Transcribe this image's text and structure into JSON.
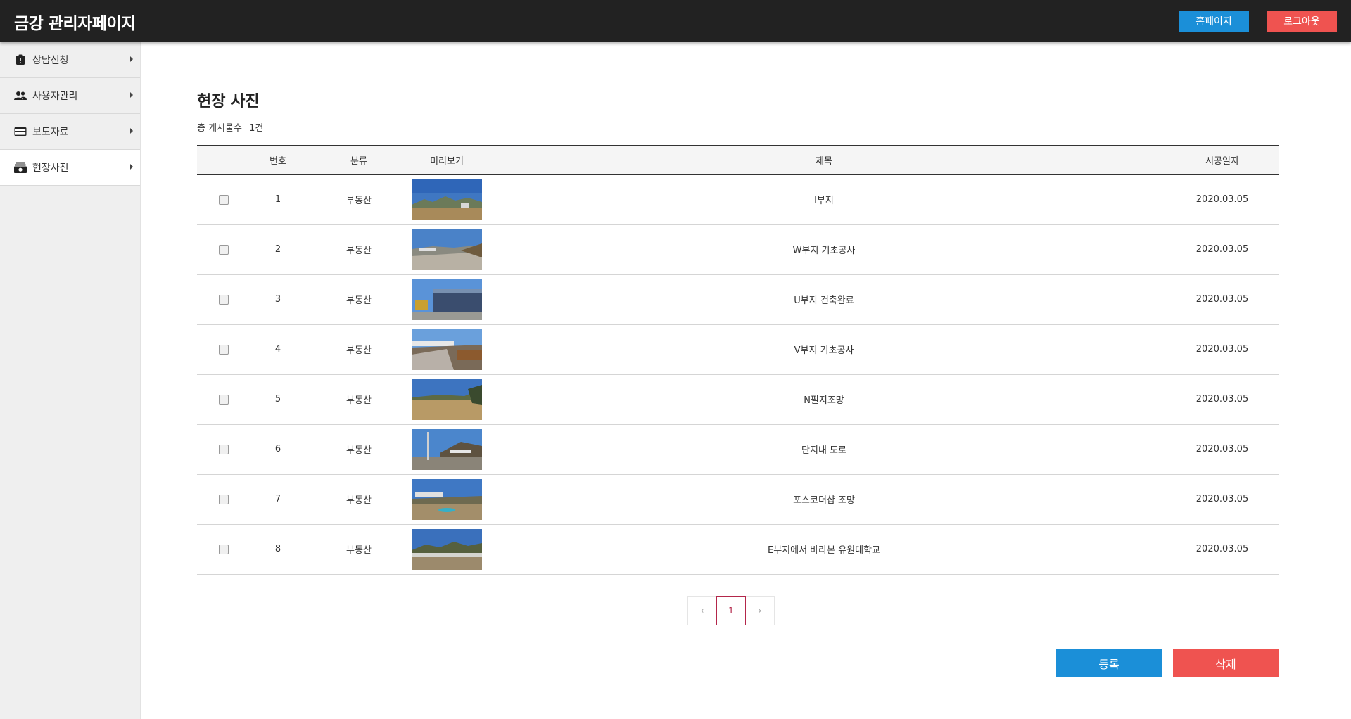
{
  "header": {
    "app_title": "금강 관리자페이지",
    "home_label": "홈페이지",
    "logout_label": "로그아웃"
  },
  "sidebar": {
    "items": [
      {
        "label": "상담신청",
        "icon": "clipboard-alert-icon",
        "active": false
      },
      {
        "label": "사용자관리",
        "icon": "users-icon",
        "active": false
      },
      {
        "label": "보도자료",
        "icon": "card-icon",
        "active": false
      },
      {
        "label": "현장사진",
        "icon": "photo-archive-icon",
        "active": true
      }
    ]
  },
  "main": {
    "title": "현장 사진",
    "total_label": "총 게시물수",
    "total_value": "1건",
    "table": {
      "headers": [
        "",
        "번호",
        "분류",
        "미리보기",
        "제목",
        "시공일자"
      ],
      "rows": [
        {
          "num": "1",
          "category": "부동산",
          "title": "I부지",
          "date": "2020.03.05"
        },
        {
          "num": "2",
          "category": "부동산",
          "title": "W부지 기초공사",
          "date": "2020.03.05"
        },
        {
          "num": "3",
          "category": "부동산",
          "title": "U부지 건축완료",
          "date": "2020.03.05"
        },
        {
          "num": "4",
          "category": "부동산",
          "title": "V부지 기초공사",
          "date": "2020.03.05"
        },
        {
          "num": "5",
          "category": "부동산",
          "title": "N필지조망",
          "date": "2020.03.05"
        },
        {
          "num": "6",
          "category": "부동산",
          "title": "단지내 도로",
          "date": "2020.03.05"
        },
        {
          "num": "7",
          "category": "부동산",
          "title": "포스코더샵 조망",
          "date": "2020.03.05"
        },
        {
          "num": "8",
          "category": "부동산",
          "title": "E부지에서 바라본 유원대학교",
          "date": "2020.03.05"
        }
      ]
    },
    "pagination": {
      "prev": "‹",
      "current": "1",
      "next": "›"
    },
    "register_label": "등록",
    "delete_label": "삭제"
  },
  "colors": {
    "topbar": "#222222",
    "blue_button": "#1b8fd8",
    "red_button": "#ef5350",
    "pager_active": "#b3264a"
  }
}
